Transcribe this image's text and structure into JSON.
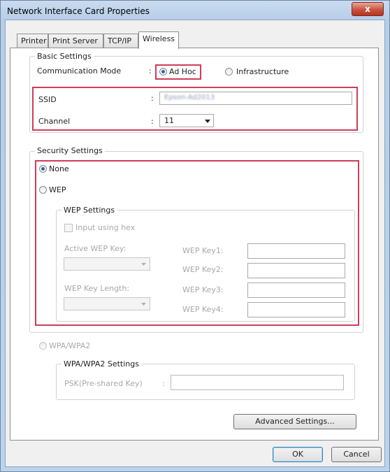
{
  "window": {
    "title": "Network Interface Card Properties",
    "close_glyph": "x"
  },
  "tabs": [
    {
      "label": "Printer"
    },
    {
      "label": "Print Server"
    },
    {
      "label": "TCP/IP"
    },
    {
      "label": "Wireless"
    }
  ],
  "basic": {
    "legend": "Basic Settings",
    "comm_mode_label": "Communication Mode",
    "colon": ":",
    "adhoc_label": "Ad Hoc",
    "infrastructure_label": "Infrastructure",
    "selected_mode": "Ad Hoc",
    "ssid_label": "SSID",
    "ssid_value": "Epson-Ad2013",
    "channel_label": "Channel",
    "channel_value": "11"
  },
  "security": {
    "legend": "Security Settings",
    "none_label": "None",
    "wep_label": "WEP",
    "selected": "None",
    "wep_settings_legend": "WEP Settings",
    "input_hex_label": "Input using hex",
    "active_key_label": "Active WEP Key:",
    "key_length_label": "WEP Key Length:",
    "key1_label": "WEP Key1:",
    "key2_label": "WEP Key2:",
    "key3_label": "WEP Key3:",
    "key4_label": "WEP Key4:",
    "wpa_label": "WPA/WPA2",
    "wpa_settings_legend": "WPA/WPA2 Settings",
    "psk_label": "PSK(Pre-shared Key)",
    "psk_colon": ":"
  },
  "buttons": {
    "advanced": "Advanced Settings...",
    "ok": "OK",
    "cancel": "Cancel"
  },
  "colors": {
    "highlight": "#d03c58",
    "title_bar": "#bcd3ec",
    "selected_radio": "#2f63b7"
  }
}
